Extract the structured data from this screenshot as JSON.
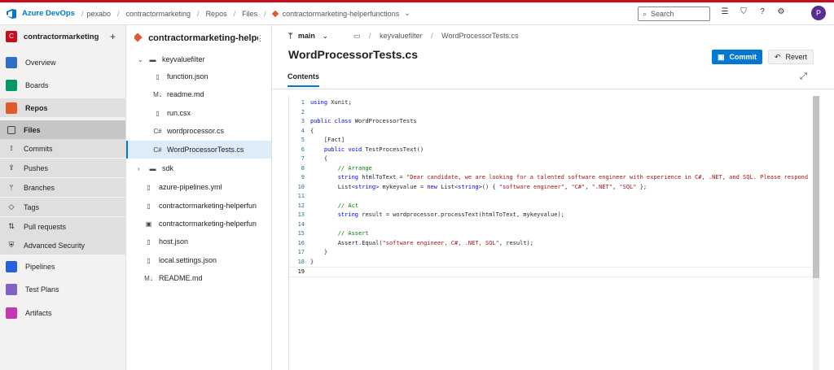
{
  "header": {
    "brand": "Azure DevOps",
    "crumbs": [
      "pexabo",
      "contractormarketing",
      "Repos",
      "Files",
      "contractormarketing-helperfunctions"
    ],
    "search_placeholder": "Search",
    "avatar_initial": "P"
  },
  "nav": {
    "project_badge": "C",
    "project_name": "contractormarketing",
    "items": [
      {
        "label": "Overview",
        "color": "#2c71c6"
      },
      {
        "label": "Boards",
        "color": "#009966"
      },
      {
        "label": "Repos",
        "color": "#e05a2b"
      },
      {
        "label": "Files"
      },
      {
        "label": "Commits"
      },
      {
        "label": "Pushes"
      },
      {
        "label": "Branches"
      },
      {
        "label": "Tags"
      },
      {
        "label": "Pull requests"
      },
      {
        "label": "Advanced Security"
      },
      {
        "label": "Pipelines",
        "color": "#2560e0"
      },
      {
        "label": "Test Plans",
        "color": "#8661c5"
      },
      {
        "label": "Artifacts",
        "color": "#c239b3"
      }
    ]
  },
  "files": {
    "repo_title": "contractormarketing-helperfunctions",
    "tree": [
      {
        "label": "keyvaluefilter",
        "icon": "folder-icon"
      },
      {
        "label": "function.json",
        "icon": "file-icon"
      },
      {
        "label": "readme.md",
        "icon": "markdown-icon"
      },
      {
        "label": "run.csx",
        "icon": "file-icon"
      },
      {
        "label": "wordprocessor.cs",
        "icon": "csharp-icon"
      },
      {
        "label": "WordProcessorTests.cs",
        "icon": "csharp-icon"
      },
      {
        "label": "sdk",
        "icon": "folder-icon"
      },
      {
        "label": "azure-pipelines.yml",
        "icon": "file-icon"
      },
      {
        "label": "contractormarketing-helperfunctions.csproj",
        "icon": "file-icon"
      },
      {
        "label": "contractormarketing-helperfunctions.sln",
        "icon": "solution-icon"
      },
      {
        "label": "host.json",
        "icon": "file-icon"
      },
      {
        "label": "local.settings.json",
        "icon": "file-icon"
      },
      {
        "label": "README.md",
        "icon": "markdown-icon"
      }
    ]
  },
  "main": {
    "branch": "main",
    "path_folder": "keyvaluefilter",
    "path_file": "WordProcessorTests.cs",
    "title": "WordProcessorTests.cs",
    "commit_label": "Commit",
    "revert_label": "Revert",
    "tab_label": "Contents"
  },
  "code": {
    "lines": [
      "using Xunit;",
      "",
      "public class WordProcessorTests",
      "{",
      "    [Fact]",
      "    public void TestProcessText()",
      "    {",
      "        // Arrange",
      "        string htmlToText = \"Dear candidate, we are looking for a talented software engineer with experience in C#, .NET, and SQL. Please respond",
      "        List<string> mykeyvalue = new List<string>() { \"software engineer\", \"C#\", \".NET\", \"SQL\" };",
      "",
      "        // Act",
      "        string result = wordprocessor.processText(htmlToText, mykeyvalue);",
      "",
      "        // Assert",
      "        Assert.Equal(\"software engineer, C#, .NET, SQL\", result);",
      "    }",
      "}",
      ""
    ]
  }
}
